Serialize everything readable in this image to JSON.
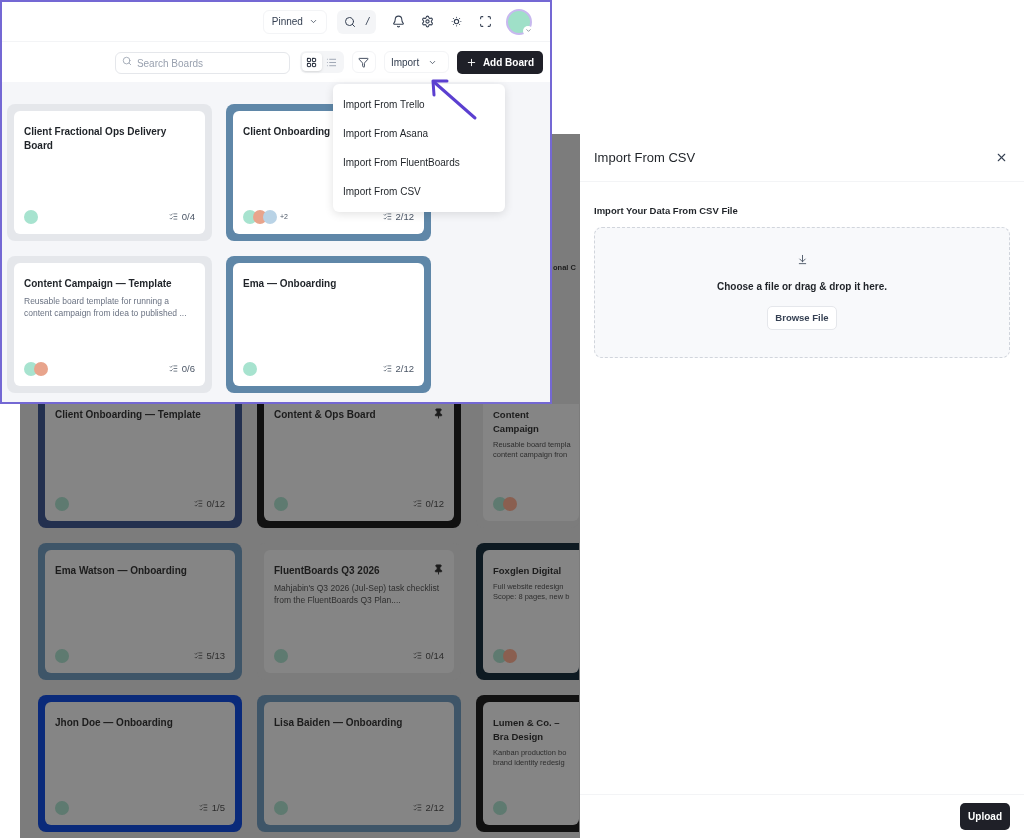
{
  "top_bar": {
    "pinned_filter": "Pinned",
    "search_shortcut": "/"
  },
  "toolbar": {
    "search": {
      "placeholder": "Search Boards"
    },
    "views": [
      {
        "kind": "grid",
        "selected": true
      },
      {
        "kind": "list",
        "selected": false
      }
    ],
    "import_button": "Import",
    "add_board_button": "Add Board"
  },
  "import_menu": [
    "Import From Trello",
    "Import From Asana",
    "Import From FluentBoards",
    "Import From CSV"
  ],
  "boards": [
    {
      "title": "Client Fractional Ops Delivery Board",
      "color": "#e5e7eb",
      "members": [
        {
          "color": "#a7e3cf"
        }
      ],
      "progress": "0/4"
    },
    {
      "title": "Client Onboarding",
      "color": "#5f87a8",
      "members": [
        {
          "color": "#a7e3cf"
        },
        {
          "color": "#e8a48c"
        },
        {
          "color": "#b9d3e6"
        }
      ],
      "more_members": "+2",
      "progress": "2/12"
    },
    {
      "title": "Content Campaign — Template",
      "description": "Reusable board template for running a content campaign from idea to published ...",
      "color": "#e5e7eb",
      "members": [
        {
          "color": "#a7e3cf"
        },
        {
          "color": "#e8a48c"
        }
      ],
      "progress": "0/6"
    },
    {
      "title": "Ema — Onboarding",
      "color": "#5f87a8",
      "members": [
        {
          "color": "#a7e3cf"
        }
      ],
      "progress": "2/12"
    }
  ],
  "background_boards": [
    {
      "title": "onal C"
    },
    {
      "title": "Client Onboarding — Template",
      "color": "#23304f",
      "members": [
        {
          "color": "#5e7a70"
        }
      ],
      "progress": "0/12",
      "pinned": false
    },
    {
      "title": "Content & Ops Board",
      "color": "#111111",
      "members": [
        {
          "color": "#5e7a70"
        }
      ],
      "progress": "0/12",
      "pinned": true
    },
    {
      "title": "Content Campaign",
      "description": "Reusable board templa content campaign fron",
      "color": "#7c7c7c",
      "members": [
        {
          "color": "#5e7a70"
        },
        {
          "color": "#8a5f50"
        }
      ],
      "pinned": false
    },
    {
      "title": "Ema Watson — Onboarding",
      "color": "#3e5568",
      "members": [
        {
          "color": "#5e7a70"
        }
      ],
      "progress": "5/13",
      "pinned": false
    },
    {
      "title": "FluentBoards Q3 2026",
      "description": "Mahjabin's Q3 2026 (Jul-Sep) task checklist from the FluentBoards Q3 Plan....",
      "color": "#7c7c7c",
      "members": [
        {
          "color": "#5e7a70"
        }
      ],
      "progress": "0/14",
      "pinned": true
    },
    {
      "title": "Foxglen Digital",
      "description": "Full website redesign Scope: 8 pages, new b",
      "color": "#0e1a22",
      "members": [
        {
          "color": "#5e7a70"
        },
        {
          "color": "#8a5f50"
        }
      ],
      "pinned": false
    },
    {
      "title": "Jhon Doe — Onboarding",
      "color": "#0a2a7a",
      "members": [
        {
          "color": "#5e7a70"
        }
      ],
      "progress": "1/5",
      "pinned": false
    },
    {
      "title": "Lisa Baiden — Onboarding",
      "color": "#3e5568",
      "members": [
        {
          "color": "#5e7a70"
        }
      ],
      "progress": "2/12",
      "pinned": false
    },
    {
      "title": "Lumen & Co. – Bra Design",
      "description": "Kanban production bo brand identity redesig",
      "color": "#111111",
      "members": [
        {
          "color": "#5e7a70"
        }
      ],
      "pinned": false
    }
  ],
  "csv_panel": {
    "title": "Import From CSV",
    "label": "Import Your Data From CSV File",
    "drop_text": "Choose a file or drag & drop it here.",
    "browse_button": "Browse File",
    "upload_button": "Upload"
  }
}
